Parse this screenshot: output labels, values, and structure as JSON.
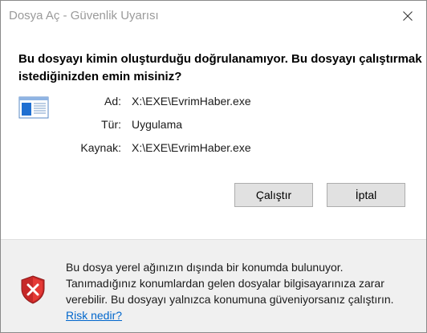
{
  "window": {
    "title": "Dosya Aç - Güvenlik Uyarısı",
    "close_icon": "close-icon"
  },
  "dialog": {
    "question_line1": "Bu dosyayı kimin oluşturduğu doğrulanamıyor. Bu dosyayı çalıştırmak",
    "question_line2": "istediğinizden emin misiniz?",
    "file_icon": "application-window-icon",
    "details": [
      {
        "label": "Ad:",
        "value": "X:\\EXE\\EvrimHaber.exe"
      },
      {
        "label": "Tür:",
        "value": "Uygulama"
      },
      {
        "label": "Kaynak:",
        "value": "X:\\EXE\\EvrimHaber.exe"
      }
    ],
    "buttons": {
      "run": "Çalıştır",
      "cancel": "İptal"
    }
  },
  "footer": {
    "shield_icon": "security-warning-shield-icon",
    "warning_line1": "Bu dosya yerel ağınızın dışında bir konumda bulunuyor.",
    "warning_line2": "Tanımadığınız konumlardan gelen dosyalar bilgisayarınıza zarar",
    "warning_line3": "verebilir. Bu dosyayı yalnızca konumuna güveniyorsanız çalıştırın.",
    "risk_link": "Risk nedir?"
  },
  "colors": {
    "footer_bg": "#f0f0f0",
    "button_bg": "#e1e1e1",
    "link": "#0066cc",
    "shield_red": "#d32f2f"
  }
}
